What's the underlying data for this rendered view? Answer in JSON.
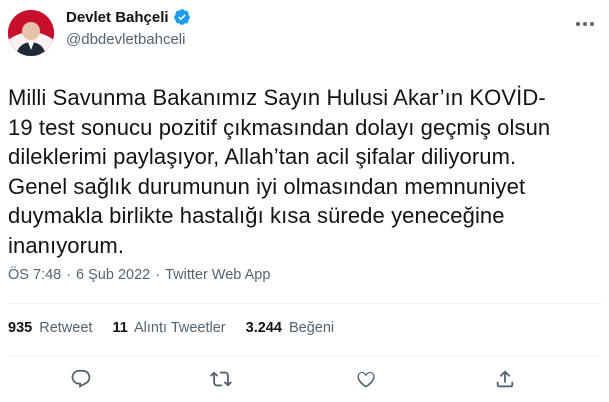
{
  "author": {
    "display_name": "Devlet Bahçeli",
    "handle": "@dbdevletbahceli",
    "verified_icon": "verified-badge-icon",
    "accent": "#1d9bf0"
  },
  "tweet_lines": [
    "Milli Savunma Bakanımız Sayın Hulusi Akar’ın KOVİD-",
    "19 test sonucu pozitif çıkmasından dolayı geçmiş olsun",
    "dileklerimi paylaşıyor, Allah’tan acil şifalar diliyorum.",
    "Genel sağlık durumunun iyi olmasından memnuniyet",
    "duymakla birlikte hastalığı kısa sürede yeneceğine",
    "inanıyorum."
  ],
  "meta": {
    "time": "ÖS 7:48",
    "sep1": "·",
    "date": "6 Şub 2022",
    "sep2": "·",
    "source": "Twitter Web App"
  },
  "stats": {
    "retweets_count": "935",
    "retweets_label": "Retweet",
    "quotes_count": "11",
    "quotes_label": "Alıntı Tweetler",
    "likes_count": "3.244",
    "likes_label": "Beğeni"
  },
  "actions": [
    "reply-icon",
    "retweet-icon",
    "like-icon",
    "share-icon"
  ]
}
